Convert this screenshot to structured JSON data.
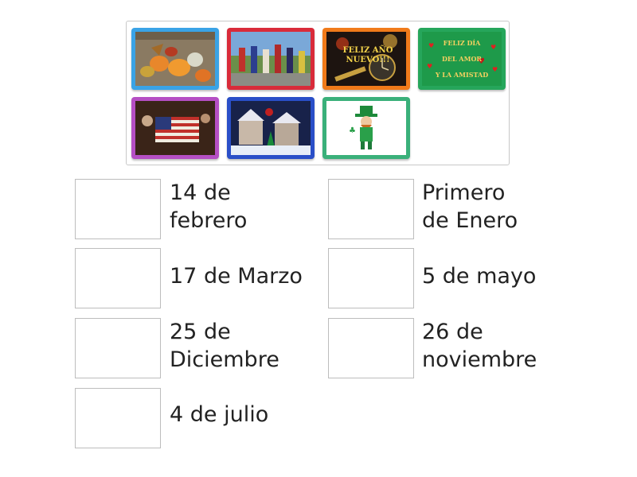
{
  "tiles": [
    {
      "name": "thanksgiving-pumpkins-image",
      "border": "#3aa3e6"
    },
    {
      "name": "cinco-de-mayo-parade-image",
      "border": "#d92b3a"
    },
    {
      "name": "new-year-clock-image",
      "border": "#f07a1a",
      "caption": "FELIZ AÑO NUEVO!!!"
    },
    {
      "name": "valentines-card-image",
      "border": "#26a65b",
      "caption_lines": [
        "FELIZ DÍA",
        "DEL AMOR",
        "Y LA AMISTAD"
      ]
    },
    {
      "name": "betsy-ross-flag-image",
      "border": "#b54fc4"
    },
    {
      "name": "christmas-scene-image",
      "border": "#2a4fc8"
    },
    {
      "name": "leprechaun-image",
      "border": "#3ab07a"
    }
  ],
  "targets": [
    {
      "label_lines": [
        "14 de",
        "febrero"
      ]
    },
    {
      "label_lines": [
        "Primero",
        "de Enero"
      ]
    },
    {
      "label_lines": [
        "17 de Marzo"
      ]
    },
    {
      "label_lines": [
        "5 de mayo"
      ]
    },
    {
      "label_lines": [
        "25 de",
        "Diciembre"
      ]
    },
    {
      "label_lines": [
        "26 de",
        "noviembre"
      ]
    },
    {
      "label_lines": [
        "4 de julio"
      ]
    }
  ]
}
